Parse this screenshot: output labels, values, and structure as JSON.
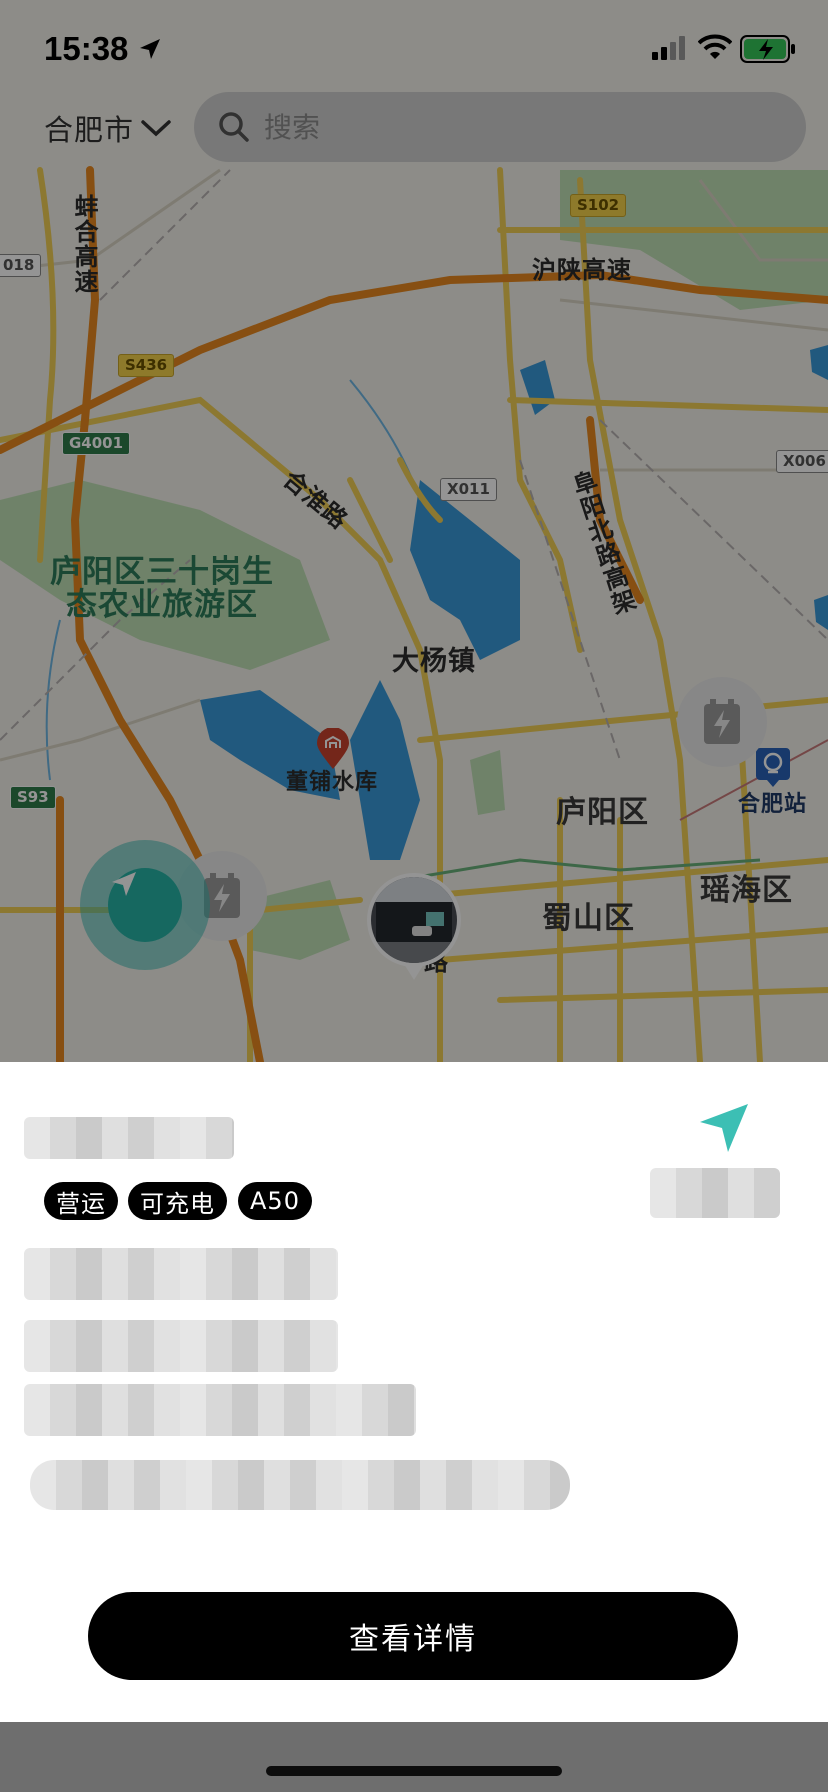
{
  "status_bar": {
    "time": "15:38"
  },
  "header": {
    "city": "合肥市",
    "search_placeholder": "搜索"
  },
  "map": {
    "road_labels": [
      {
        "id": "bengbu-expressway",
        "text": "蚌合高速"
      },
      {
        "id": "hushan-expressway",
        "text": "沪陕高速"
      },
      {
        "id": "hehuai-road",
        "text": "合淮路"
      },
      {
        "id": "fuyang-north-elevated",
        "text": "阜阳北路高架"
      }
    ],
    "route_badges": [
      {
        "id": "badge-s102",
        "text": "S102",
        "style": "yellow"
      },
      {
        "id": "badge-s436",
        "text": "S436",
        "style": "yellow"
      },
      {
        "id": "badge-g4001",
        "text": "G4001",
        "style": "green"
      },
      {
        "id": "badge-x011",
        "text": "X011",
        "style": "white"
      },
      {
        "id": "badge-x006",
        "text": "X006",
        "style": "white"
      },
      {
        "id": "badge-s93",
        "text": "S93",
        "style": "green"
      },
      {
        "id": "badge-018",
        "text": "018",
        "style": "white"
      }
    ],
    "place_labels": [
      {
        "id": "ecological-park",
        "text": "庐阳区三十岗生\n态农业旅游区"
      },
      {
        "id": "dayang-town",
        "text": "大杨镇"
      },
      {
        "id": "dongpu-reservoir",
        "text": "董铺水库"
      },
      {
        "id": "luyang-district",
        "text": "庐阳区"
      },
      {
        "id": "shushan-district",
        "text": "蜀山区"
      },
      {
        "id": "yaohai-district",
        "text": "瑶海区"
      },
      {
        "id": "hefei-station",
        "text": "合肥站"
      },
      {
        "id": "road-fragment",
        "text": "路"
      }
    ],
    "colors": {
      "land": "#f3f1ea",
      "water": "#3a9ad9",
      "greenery": "#bfe0b5",
      "highway": "#e8891f",
      "major_road": "#f1cf55"
    }
  },
  "sheet": {
    "tags": [
      "营运",
      "可充电",
      "A50"
    ],
    "button_label": "查看详情",
    "accent_color": "#3cbfb4"
  }
}
